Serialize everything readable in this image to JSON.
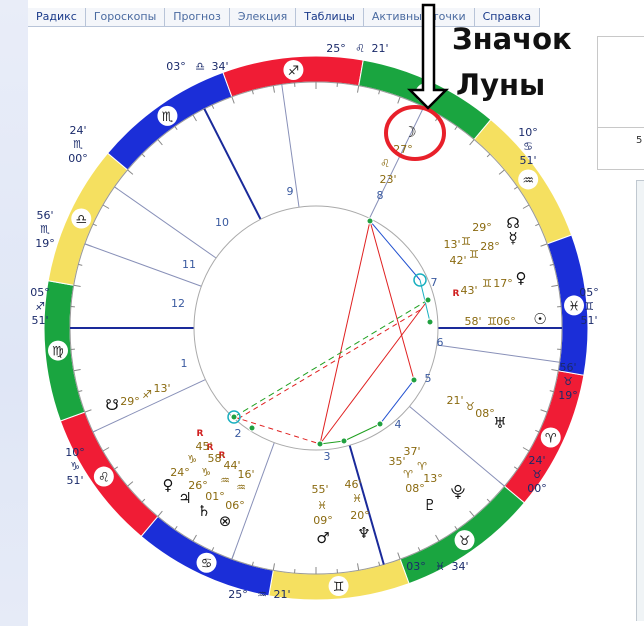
{
  "tabs": [
    {
      "label": "Радикс",
      "dim": false
    },
    {
      "label": "Гороскопы",
      "dim": true
    },
    {
      "label": "Прогноз",
      "dim": true
    },
    {
      "label": "Элекция",
      "dim": true
    },
    {
      "label": "Таблицы",
      "dim": false
    },
    {
      "label": "Активные точки",
      "dim": true
    },
    {
      "label": "Справка",
      "dim": false
    }
  ],
  "annotation": {
    "line1": "Значок",
    "line2": "Луны"
  },
  "side_panel": {
    "value": "5"
  },
  "colors": {
    "fire": "#f01c35",
    "earth": "#1aa540",
    "air": "#f5e060",
    "water": "#1b2ed8"
  },
  "signs": [
    {
      "glyph": "♈",
      "element": "fire"
    },
    {
      "glyph": "♉",
      "element": "earth"
    },
    {
      "glyph": "♊",
      "element": "air"
    },
    {
      "glyph": "♋",
      "element": "water"
    },
    {
      "glyph": "♌",
      "element": "fire"
    },
    {
      "glyph": "♍",
      "element": "earth"
    },
    {
      "glyph": "♎",
      "element": "air"
    },
    {
      "glyph": "♏",
      "element": "water"
    },
    {
      "glyph": "♐",
      "element": "fire"
    },
    {
      "glyph": "♑",
      "element": "earth"
    },
    {
      "glyph": "♒",
      "element": "air"
    },
    {
      "glyph": "♓",
      "element": "water"
    }
  ],
  "cusp_labels": [
    {
      "deg": "25°",
      "sign": "♌",
      "min": "21'"
    },
    {
      "deg": "10°",
      "sign": "♋",
      "min": "51'"
    },
    {
      "deg": "05°",
      "sign": "♊",
      "min": "51'"
    },
    {
      "deg": "56'",
      "sign": "♉",
      "min": "19°"
    },
    {
      "deg": "24'",
      "sign": "♉",
      "min": "00°"
    },
    {
      "deg": "03°",
      "sign": "♓",
      "min": "34'"
    },
    {
      "deg": "25°",
      "sign": "♒",
      "min": "21'"
    },
    {
      "deg": "10°",
      "sign": "♑",
      "min": "51'"
    },
    {
      "deg": "05°",
      "sign": "♐",
      "min": "51'"
    },
    {
      "deg": "56'",
      "sign": "♏",
      "min": "19°"
    },
    {
      "deg": "24'",
      "sign": "♏",
      "min": "00°"
    },
    {
      "deg": "03°",
      "sign": "♎",
      "min": "34'"
    }
  ],
  "houses": [
    "1",
    "2",
    "3",
    "4",
    "5",
    "6",
    "7",
    "8",
    "9",
    "10",
    "11",
    "12"
  ],
  "planets": [
    {
      "glyph": "☽",
      "deg": "27°",
      "sign": "♌",
      "min": "23'",
      "retro": ""
    },
    {
      "glyph": "☊",
      "deg": "29°",
      "sign": "♊",
      "min": "13'",
      "retro": ""
    },
    {
      "glyph": "☿",
      "deg": "28°",
      "sign": "♊",
      "min": "42'",
      "retro": ""
    },
    {
      "glyph": "♀",
      "deg": "17°",
      "sign": "♊",
      "min": "43'",
      "retro": "R"
    },
    {
      "glyph": "☉",
      "deg": "06°",
      "sign": "♊",
      "min": "58'",
      "retro": ""
    },
    {
      "glyph": "♅",
      "deg": "08°",
      "sign": "♉",
      "min": "21'",
      "retro": ""
    },
    {
      "glyph": "⯓",
      "deg": "13°",
      "sign": "♈",
      "min": "37'",
      "retro": ""
    },
    {
      "glyph": "♇",
      "deg": "08°",
      "sign": "♈",
      "min": "35'",
      "retro": ""
    },
    {
      "glyph": "♆",
      "deg": "20°",
      "sign": "♓",
      "min": "46'",
      "retro": ""
    },
    {
      "glyph": "♂",
      "deg": "09°",
      "sign": "♓",
      "min": "55'",
      "retro": ""
    },
    {
      "glyph": "⊗",
      "deg": "06°",
      "sign": "♒",
      "min": "16'",
      "retro": ""
    },
    {
      "glyph": "♄",
      "deg": "01°",
      "sign": "♒",
      "min": "44'",
      "retro": "R"
    },
    {
      "glyph": "♃",
      "deg": "26°",
      "sign": "♑",
      "min": "58'",
      "retro": "R"
    },
    {
      "glyph": "♀",
      "deg": "24°",
      "sign": "♑",
      "min": "45'",
      "retro": "R"
    },
    {
      "glyph": "☋",
      "deg": "29°",
      "sign": "♐",
      "min": "13'",
      "retro": ""
    }
  ]
}
